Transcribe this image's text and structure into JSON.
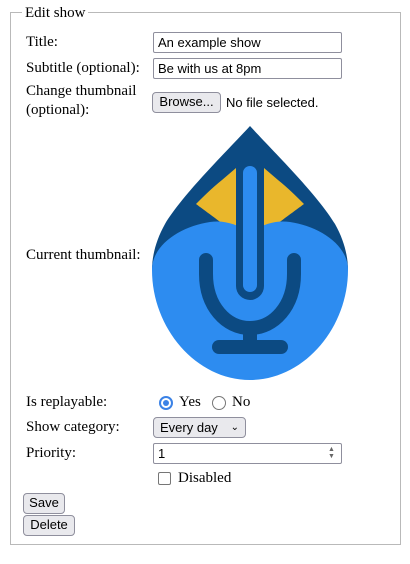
{
  "form": {
    "legend": "Edit show",
    "title_label": "Title:",
    "title_value": "An example show",
    "subtitle_label": "Subtitle (optional):",
    "subtitle_value": "Be with us at 8pm",
    "thumbnail_label_line1": "Change thumbnail",
    "thumbnail_label_line2": "(optional):",
    "browse_label": "Browse...",
    "file_status": "No file selected.",
    "current_thumbnail_label": "Current thumbnail:",
    "replayable_label": "Is replayable:",
    "replayable_yes": "Yes",
    "replayable_no": "No",
    "replayable_selected": "Yes",
    "category_label": "Show category:",
    "category_value": "Every day",
    "priority_label": "Priority:",
    "priority_value": "1",
    "disabled_label": "Disabled",
    "disabled_checked": false,
    "save_label": "Save",
    "delete_label": "Delete"
  },
  "thumbnail": {
    "icon": "microphone-drop-logo",
    "colors": {
      "dark_blue": "#0c4a82",
      "light_blue": "#2d8cf0",
      "yellow": "#e9b72c"
    }
  },
  "colors": {
    "accent": "#3b82e6",
    "border": "#8f8f9d",
    "button_bg": "#e9e9ed"
  }
}
